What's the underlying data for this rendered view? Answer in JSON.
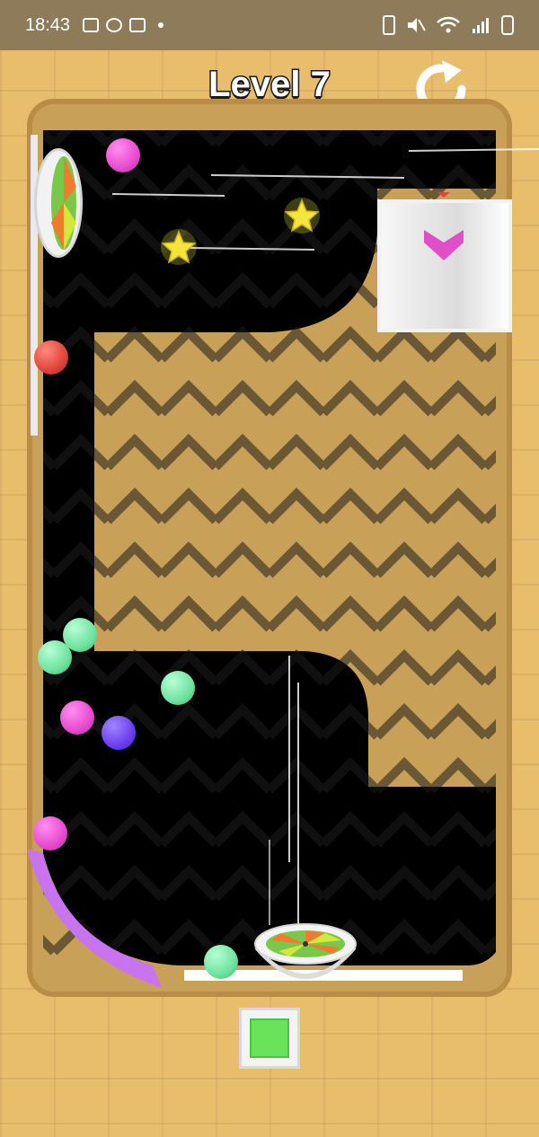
{
  "status_bar": {
    "time": "18:43"
  },
  "header": {
    "level_label": "Level 7",
    "restart_icon": "restart-icon"
  },
  "colors": {
    "track": "#000000",
    "brick": "#e8bd6c",
    "magenta_ball": "#e84bd0",
    "red_ball": "#e0453a",
    "green_ball": "#6fe3a0",
    "purple_ball": "#6c3ff0",
    "star": "#f5e53a",
    "ramp": "#c873f0",
    "goal_arrow": "#e04ec8",
    "launch": "#68e35a"
  },
  "icons": {
    "star": "star-icon",
    "arrow": "down-arrow-icon",
    "square": "square-button-icon"
  }
}
